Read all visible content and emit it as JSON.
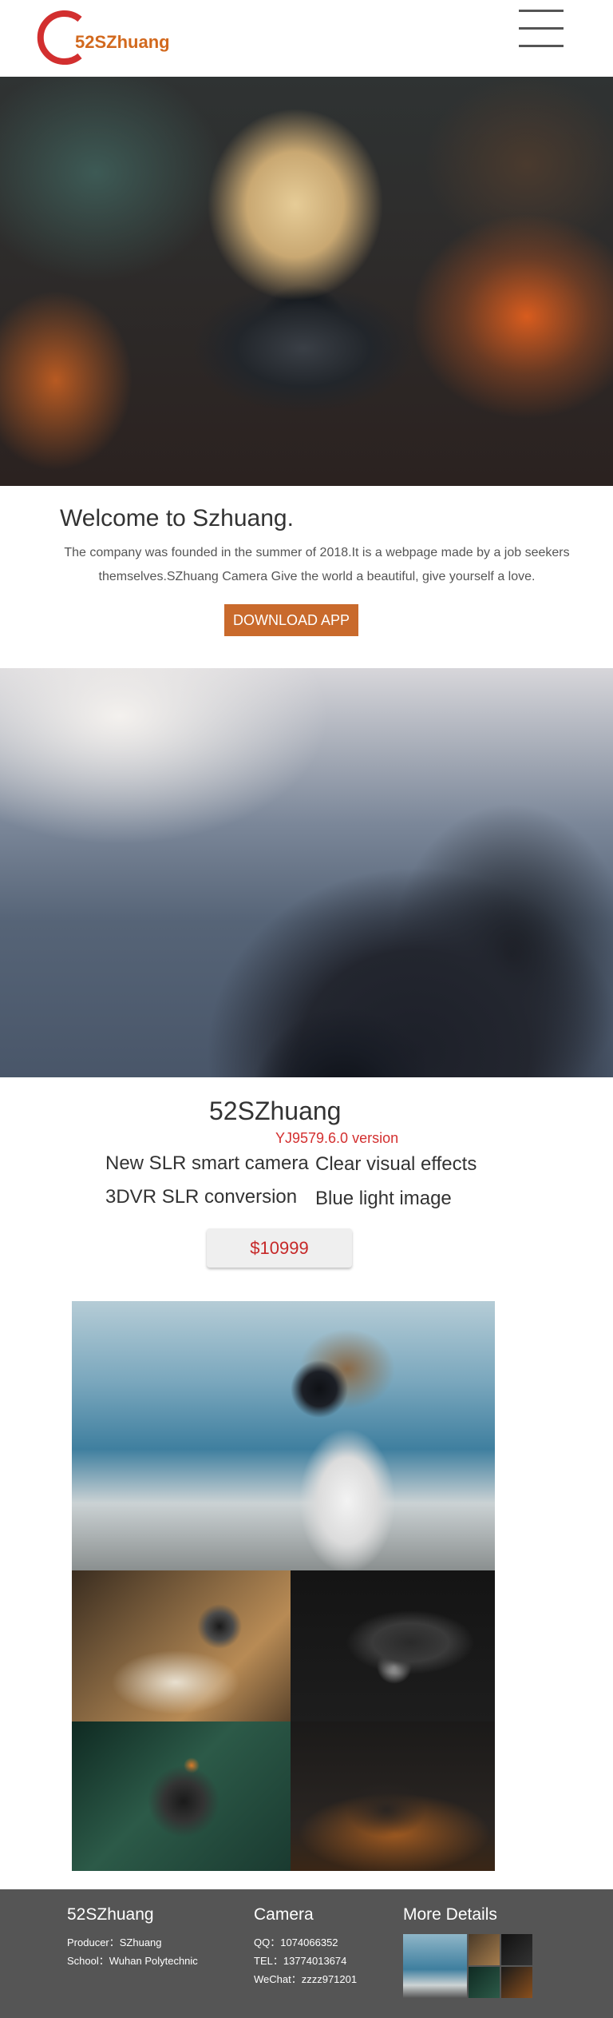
{
  "header": {
    "logo_text": "52SZhuang",
    "brand_color": "#d2691e"
  },
  "welcome": {
    "title": "Welcome to Szhuang.",
    "body": "The company was founded in the summer of 2018.It is a webpage made by a job seekers themselves.SZhuang Camera Give the world a beautiful, give yourself a love.",
    "download_label": "DOWNLOAD APP",
    "button_color": "#c96a2c"
  },
  "product": {
    "name": "52SZhuang",
    "version": "YJ9579.6.0 version",
    "features": [
      "New SLR smart camera",
      "Clear visual effects",
      "3DVR SLR conversion",
      "Blue light image"
    ],
    "price": "$10999",
    "price_color": "#c62828"
  },
  "footer": {
    "col1": {
      "title": "52SZhuang",
      "producer": "Producer：SZhuang",
      "school": "School：Wuhan Polytechnic"
    },
    "col2": {
      "title": "Camera",
      "qq": "QQ：1074066352",
      "tel": "TEL：13774013674",
      "wechat": "WeChat：zzzz971201"
    },
    "col3": {
      "title": "More Details"
    },
    "background": "#555555"
  }
}
